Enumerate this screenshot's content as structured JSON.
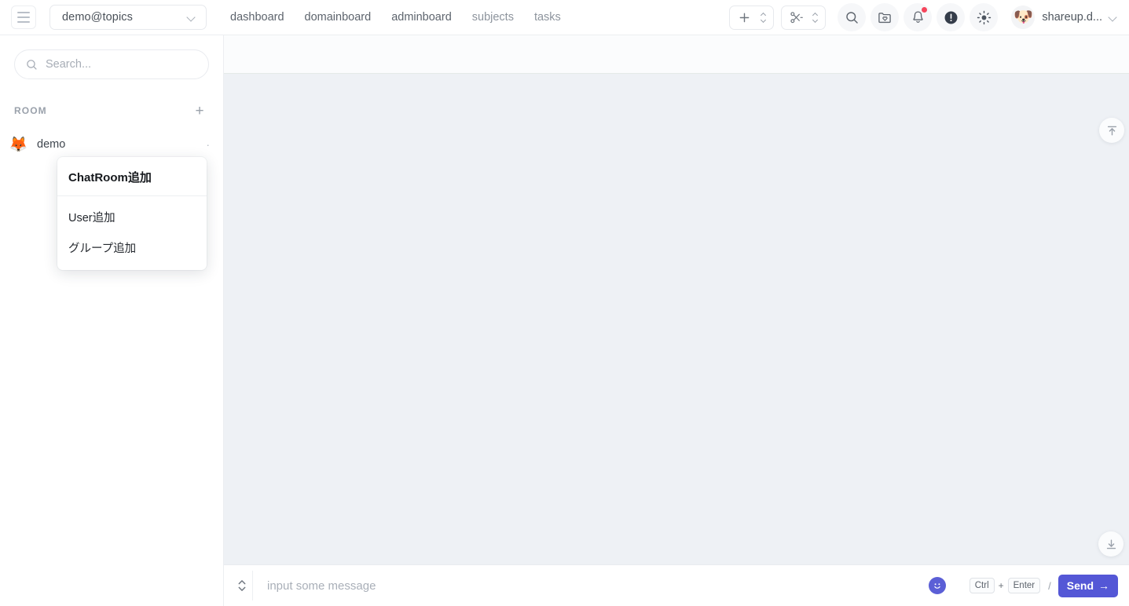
{
  "topbar": {
    "menu_icon": "hamburger-icon",
    "workspace": {
      "label": "demo@topics",
      "chevron_icon": "chevron-down-icon"
    },
    "tabs": [
      {
        "label": "dashboard",
        "muted": false
      },
      {
        "label": "domainboard",
        "muted": false
      },
      {
        "label": "adminboard",
        "muted": false
      },
      {
        "label": "subjects",
        "muted": true
      },
      {
        "label": "tasks",
        "muted": true
      }
    ],
    "add_group": {
      "icon": "plus-icon",
      "stepper_icon": "up-down-chevron-icon"
    },
    "cut_group": {
      "icon": "scissors-icon",
      "stepper_icon": "up-down-chevron-icon"
    },
    "icons": [
      {
        "name": "search-icon"
      },
      {
        "name": "folder-heart-icon"
      },
      {
        "name": "bell-icon",
        "badge": true
      },
      {
        "name": "alert-circle-icon"
      },
      {
        "name": "brightness-icon"
      }
    ],
    "user": {
      "avatar_emoji": "🐶",
      "name": "shareup.d...",
      "chevron_icon": "chevron-down-icon"
    }
  },
  "sidebar": {
    "search": {
      "placeholder": "Search...",
      "value": "",
      "icon": "search-icon"
    },
    "section": {
      "title": "ROOM",
      "add_icon": "plus-icon",
      "add_label": "+"
    },
    "rooms": [
      {
        "avatar_emoji": "🦊",
        "name": "demo",
        "more_label": "·"
      }
    ]
  },
  "dropdown": {
    "header": "ChatRoom追加",
    "items": [
      {
        "label": "User追加"
      },
      {
        "label": "グループ追加"
      }
    ]
  },
  "main": {
    "scroll_top_icon": "arrow-up-to-line-icon",
    "scroll_bottom_icon": "arrow-down-to-line-icon"
  },
  "composer": {
    "expand_icon": "up-down-chevron-icon",
    "input": {
      "placeholder": "input some message",
      "value": ""
    },
    "emoji_icon": "smiley-icon",
    "shortcut": {
      "key1": "Ctrl",
      "plus": "+",
      "key2": "Enter",
      "separator": "/"
    },
    "send": {
      "label": "Send",
      "arrow": "→"
    }
  },
  "colors": {
    "accent": "#5457d6",
    "badge": "#f5455c",
    "content_bg": "#eef1f5",
    "panel_bg": "#ffffff"
  }
}
